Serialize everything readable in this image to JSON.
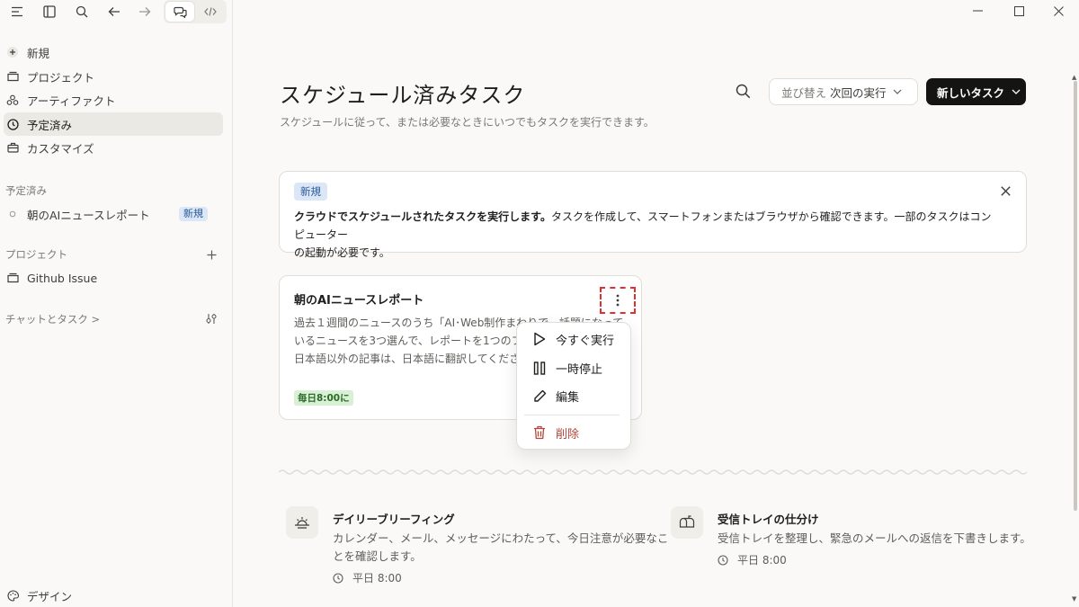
{
  "window": {
    "minimize": "—",
    "maximize": "☐",
    "close": "✕"
  },
  "sidebar": {
    "nav": [
      {
        "label": "新規",
        "icon": "plus-circle-icon"
      },
      {
        "label": "プロジェクト",
        "icon": "folder-icon"
      },
      {
        "label": "アーティファクト",
        "icon": "artifact-icon"
      },
      {
        "label": "予定済み",
        "icon": "clock-icon",
        "active": true
      },
      {
        "label": "カスタマイズ",
        "icon": "briefcase-icon"
      }
    ],
    "scheduled_section": {
      "label": "予定済み",
      "items": [
        {
          "label": "朝のAIニュースレポート",
          "badge": "新規"
        }
      ]
    },
    "projects_section": {
      "label": "プロジェクト",
      "items": [
        {
          "label": "Github Issue"
        }
      ]
    },
    "chats_section": {
      "label": "チャットとタスク >"
    },
    "footer": {
      "label": "デザイン"
    }
  },
  "main": {
    "title": "スケジュール済みタスク",
    "subtitle": "スケジュールに従って、または必要なときにいつでもタスクを実行できます。",
    "sort": {
      "prefix": "並び替え",
      "value": "次回の実行"
    },
    "new_task_label": "新しいタスク",
    "banner": {
      "tag": "新規",
      "bold_text": "クラウドでスケジュールされたタスクを実行します。",
      "line1_rest": "タスクを作成して、スマートフォンまたはブラウザから確認できます。一部のタスクはコンピューター",
      "line2": "の起動が必要です。"
    },
    "task_card": {
      "name": "朝のAIニュースレポート",
      "desc_lines": [
        "過去１週間のニュースのうち「AI･Web制作まわりで、話題になって",
        "いるニュースを3つ選んで、レポートを1つのファイルにまとめて",
        "日本語以外の記事は、日本語に翻訳してください。"
      ],
      "schedule": "毎日8:00に"
    },
    "menu": {
      "run_now": "今すぐ実行",
      "pause": "一時停止",
      "edit": "編集",
      "delete": "削除"
    },
    "templates": [
      {
        "name": "デイリーブリーフィング",
        "desc_lines": [
          "カレンダー、メール、メッセージにわたって、今日注意が必要なこ",
          "とを確認します。"
        ],
        "time": "平日 8:00",
        "icon": "sunrise-icon"
      },
      {
        "name": "受信トレイの仕分け",
        "desc_lines": [
          "受信トレイを整理し、緊急のメールへの返信を下書きします。"
        ],
        "time": "平日 8:00",
        "icon": "mailbox-icon"
      }
    ]
  }
}
